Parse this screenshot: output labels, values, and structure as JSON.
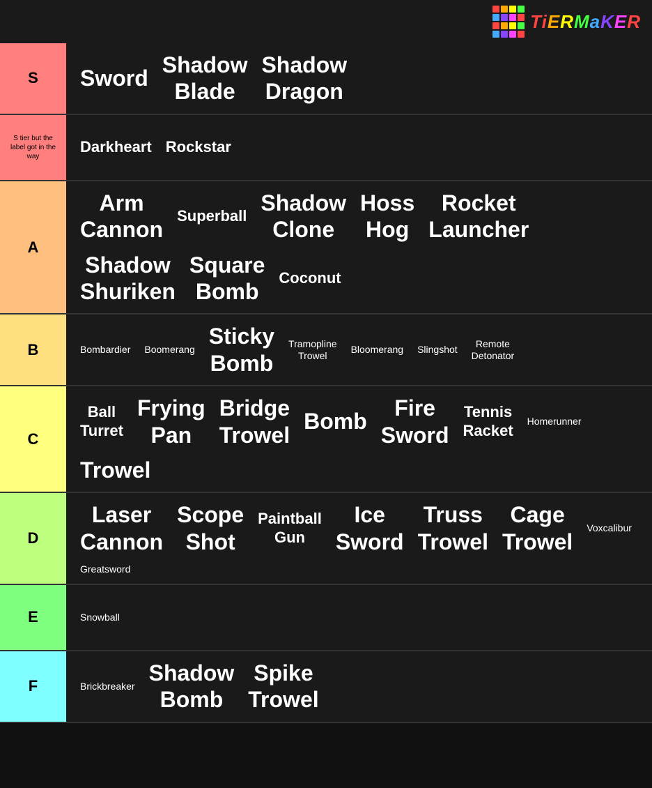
{
  "tiers": [
    {
      "id": "s",
      "label": "S",
      "color": "#ff7f7f",
      "items": [
        {
          "text": "Sword",
          "size": "large"
        },
        {
          "text": "Shadow Blade",
          "size": "large"
        },
        {
          "text": "Shadow Dragon",
          "size": "large"
        }
      ]
    },
    {
      "id": "s-note",
      "label": "S tier but the label got in the way",
      "color": "#ff7f7f",
      "items": [
        {
          "text": "Darkheart",
          "size": "medium"
        },
        {
          "text": "Rockstar",
          "size": "medium"
        }
      ]
    },
    {
      "id": "a",
      "label": "A",
      "color": "#ffbf7f",
      "items": [
        {
          "text": "Arm Cannon",
          "size": "large"
        },
        {
          "text": "Superball",
          "size": "medium"
        },
        {
          "text": "Shadow Clone",
          "size": "large"
        },
        {
          "text": "Hoss Hog",
          "size": "large"
        },
        {
          "text": "Rocket Launcher",
          "size": "large"
        },
        {
          "text": "Shadow Shuriken",
          "size": "large"
        },
        {
          "text": "Square Bomb",
          "size": "large"
        },
        {
          "text": "Coconut",
          "size": "medium"
        }
      ]
    },
    {
      "id": "b",
      "label": "B",
      "color": "#ffdf80",
      "items": [
        {
          "text": "Bombardier",
          "size": "small"
        },
        {
          "text": "Boomerang",
          "size": "small"
        },
        {
          "text": "Sticky Bomb",
          "size": "large"
        },
        {
          "text": "Tramopline Trowel",
          "size": "small"
        },
        {
          "text": "Bloomerang",
          "size": "small"
        },
        {
          "text": "Slingshot",
          "size": "small"
        },
        {
          "text": "Remote Detonator",
          "size": "small"
        }
      ]
    },
    {
      "id": "c",
      "label": "C",
      "color": "#ffff7f",
      "items": [
        {
          "text": "Ball Turret",
          "size": "medium"
        },
        {
          "text": "Frying Pan",
          "size": "large"
        },
        {
          "text": "Bridge Trowel",
          "size": "large"
        },
        {
          "text": "Bomb",
          "size": "large"
        },
        {
          "text": "Fire Sword",
          "size": "large"
        },
        {
          "text": "Tennis Racket",
          "size": "medium"
        },
        {
          "text": "Homerunner",
          "size": "small"
        },
        {
          "text": "Trowel",
          "size": "large"
        }
      ]
    },
    {
      "id": "d",
      "label": "D",
      "color": "#bfff7f",
      "items": [
        {
          "text": "Laser Cannon",
          "size": "large"
        },
        {
          "text": "Scope Shot",
          "size": "large"
        },
        {
          "text": "Paintball Gun",
          "size": "medium"
        },
        {
          "text": "Ice Sword",
          "size": "large"
        },
        {
          "text": "Truss Trowel",
          "size": "large"
        },
        {
          "text": "Cage Trowel",
          "size": "large"
        },
        {
          "text": "Voxcalibur",
          "size": "small"
        },
        {
          "text": "Greatsword",
          "size": "small"
        }
      ]
    },
    {
      "id": "e",
      "label": "E",
      "color": "#7fff7f",
      "items": [
        {
          "text": "Snowball",
          "size": "small"
        }
      ]
    },
    {
      "id": "f",
      "label": "F",
      "color": "#7fffff",
      "items": [
        {
          "text": "Brickbreaker",
          "size": "small"
        },
        {
          "text": "Shadow Bomb",
          "size": "large"
        },
        {
          "text": "Spike Trowel",
          "size": "large"
        }
      ]
    }
  ],
  "logo": {
    "text": "TiERMaKER",
    "dots": [
      "#ff4444",
      "#ffaa00",
      "#ffff00",
      "#44ff44",
      "#44aaff",
      "#8844ff",
      "#ff44ff",
      "#ff4444",
      "#ff4444",
      "#ffaa00",
      "#ffff00",
      "#44ff44",
      "#44aaff",
      "#8844ff",
      "#ff44ff",
      "#ff4444"
    ]
  }
}
